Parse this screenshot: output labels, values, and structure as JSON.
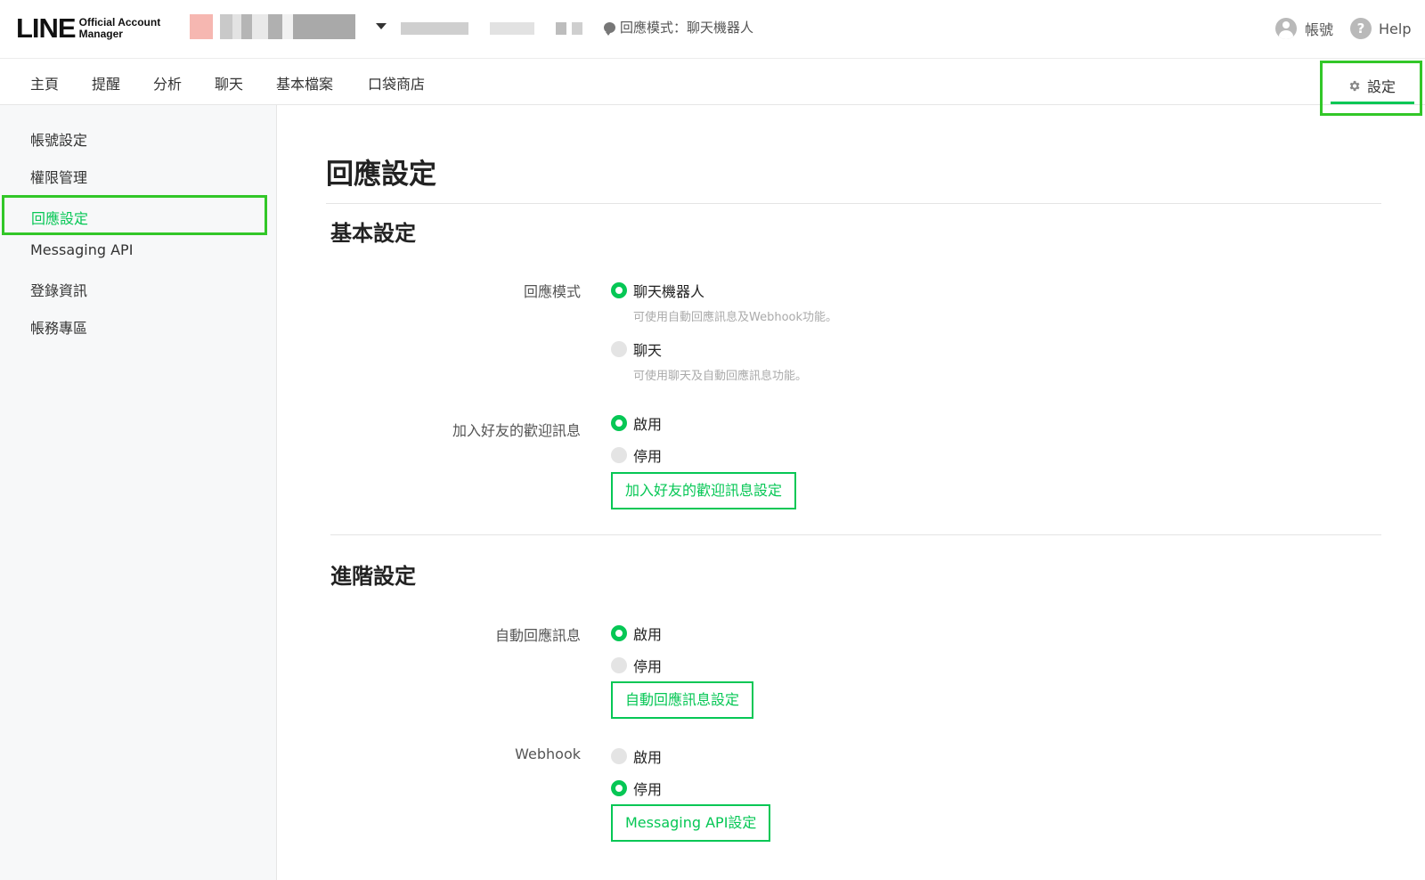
{
  "brand": {
    "logo_main": "LINE",
    "logo_sub_1": "Official Account",
    "logo_sub_2": "Manager"
  },
  "header": {
    "mode_text": "回應模式：聊天機器人",
    "account_label": "帳號",
    "help_label": "Help"
  },
  "nav": {
    "items": [
      "主頁",
      "提醒",
      "分析",
      "聊天",
      "基本檔案",
      "口袋商店"
    ],
    "settings_label": "設定"
  },
  "sidebar": {
    "items": [
      "帳號設定",
      "權限管理",
      "回應設定",
      "Messaging API",
      "登錄資訊",
      "帳務專區"
    ],
    "active": "回應設定"
  },
  "main": {
    "title": "回應設定",
    "basic": {
      "title": "基本設定",
      "response_mode": {
        "label": "回應模式",
        "option_bot": "聊天機器人",
        "option_bot_hint": "可使用自動回應訊息及Webhook功能。",
        "option_chat": "聊天",
        "option_chat_hint": "可使用聊天及自動回應訊息功能。",
        "selected": "聊天機器人"
      },
      "welcome": {
        "label": "加入好友的歡迎訊息",
        "on": "啟用",
        "off": "停用",
        "selected": "啟用",
        "button": "加入好友的歡迎訊息設定"
      }
    },
    "advanced": {
      "title": "進階設定",
      "auto_reply": {
        "label": "自動回應訊息",
        "on": "啟用",
        "off": "停用",
        "selected": "啟用",
        "button": "自動回應訊息設定"
      },
      "webhook": {
        "label": "Webhook",
        "on": "啟用",
        "off": "停用",
        "selected": "停用",
        "button": "Messaging API設定"
      }
    }
  },
  "colors": {
    "brand_green": "#06c755",
    "highlight_green": "#32c728"
  }
}
